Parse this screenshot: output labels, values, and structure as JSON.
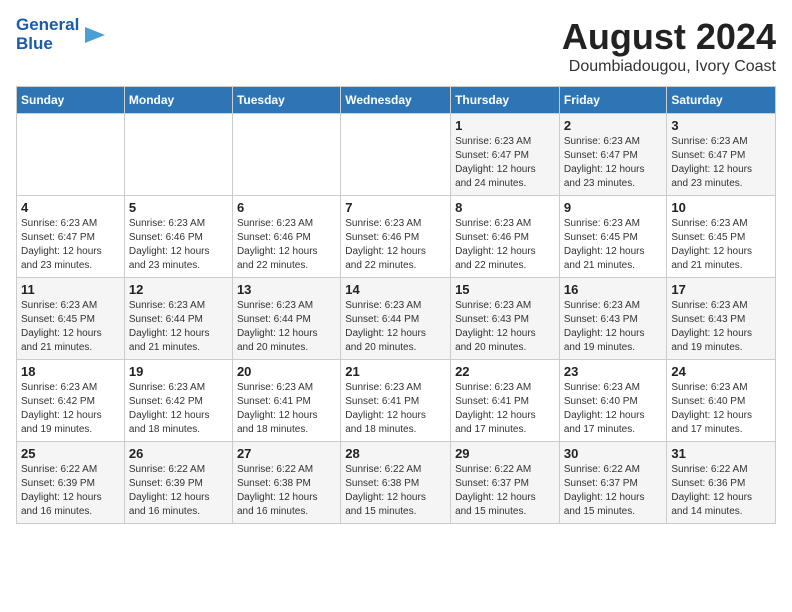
{
  "header": {
    "logo_line1": "General",
    "logo_line2": "Blue",
    "main_title": "August 2024",
    "subtitle": "Doumbiadougou, Ivory Coast"
  },
  "weekdays": [
    "Sunday",
    "Monday",
    "Tuesday",
    "Wednesday",
    "Thursday",
    "Friday",
    "Saturday"
  ],
  "weeks": [
    [
      {
        "day": "",
        "info": ""
      },
      {
        "day": "",
        "info": ""
      },
      {
        "day": "",
        "info": ""
      },
      {
        "day": "",
        "info": ""
      },
      {
        "day": "1",
        "info": "Sunrise: 6:23 AM\nSunset: 6:47 PM\nDaylight: 12 hours\nand 24 minutes."
      },
      {
        "day": "2",
        "info": "Sunrise: 6:23 AM\nSunset: 6:47 PM\nDaylight: 12 hours\nand 23 minutes."
      },
      {
        "day": "3",
        "info": "Sunrise: 6:23 AM\nSunset: 6:47 PM\nDaylight: 12 hours\nand 23 minutes."
      }
    ],
    [
      {
        "day": "4",
        "info": "Sunrise: 6:23 AM\nSunset: 6:47 PM\nDaylight: 12 hours\nand 23 minutes."
      },
      {
        "day": "5",
        "info": "Sunrise: 6:23 AM\nSunset: 6:46 PM\nDaylight: 12 hours\nand 23 minutes."
      },
      {
        "day": "6",
        "info": "Sunrise: 6:23 AM\nSunset: 6:46 PM\nDaylight: 12 hours\nand 22 minutes."
      },
      {
        "day": "7",
        "info": "Sunrise: 6:23 AM\nSunset: 6:46 PM\nDaylight: 12 hours\nand 22 minutes."
      },
      {
        "day": "8",
        "info": "Sunrise: 6:23 AM\nSunset: 6:46 PM\nDaylight: 12 hours\nand 22 minutes."
      },
      {
        "day": "9",
        "info": "Sunrise: 6:23 AM\nSunset: 6:45 PM\nDaylight: 12 hours\nand 21 minutes."
      },
      {
        "day": "10",
        "info": "Sunrise: 6:23 AM\nSunset: 6:45 PM\nDaylight: 12 hours\nand 21 minutes."
      }
    ],
    [
      {
        "day": "11",
        "info": "Sunrise: 6:23 AM\nSunset: 6:45 PM\nDaylight: 12 hours\nand 21 minutes."
      },
      {
        "day": "12",
        "info": "Sunrise: 6:23 AM\nSunset: 6:44 PM\nDaylight: 12 hours\nand 21 minutes."
      },
      {
        "day": "13",
        "info": "Sunrise: 6:23 AM\nSunset: 6:44 PM\nDaylight: 12 hours\nand 20 minutes."
      },
      {
        "day": "14",
        "info": "Sunrise: 6:23 AM\nSunset: 6:44 PM\nDaylight: 12 hours\nand 20 minutes."
      },
      {
        "day": "15",
        "info": "Sunrise: 6:23 AM\nSunset: 6:43 PM\nDaylight: 12 hours\nand 20 minutes."
      },
      {
        "day": "16",
        "info": "Sunrise: 6:23 AM\nSunset: 6:43 PM\nDaylight: 12 hours\nand 19 minutes."
      },
      {
        "day": "17",
        "info": "Sunrise: 6:23 AM\nSunset: 6:43 PM\nDaylight: 12 hours\nand 19 minutes."
      }
    ],
    [
      {
        "day": "18",
        "info": "Sunrise: 6:23 AM\nSunset: 6:42 PM\nDaylight: 12 hours\nand 19 minutes."
      },
      {
        "day": "19",
        "info": "Sunrise: 6:23 AM\nSunset: 6:42 PM\nDaylight: 12 hours\nand 18 minutes."
      },
      {
        "day": "20",
        "info": "Sunrise: 6:23 AM\nSunset: 6:41 PM\nDaylight: 12 hours\nand 18 minutes."
      },
      {
        "day": "21",
        "info": "Sunrise: 6:23 AM\nSunset: 6:41 PM\nDaylight: 12 hours\nand 18 minutes."
      },
      {
        "day": "22",
        "info": "Sunrise: 6:23 AM\nSunset: 6:41 PM\nDaylight: 12 hours\nand 17 minutes."
      },
      {
        "day": "23",
        "info": "Sunrise: 6:23 AM\nSunset: 6:40 PM\nDaylight: 12 hours\nand 17 minutes."
      },
      {
        "day": "24",
        "info": "Sunrise: 6:23 AM\nSunset: 6:40 PM\nDaylight: 12 hours\nand 17 minutes."
      }
    ],
    [
      {
        "day": "25",
        "info": "Sunrise: 6:22 AM\nSunset: 6:39 PM\nDaylight: 12 hours\nand 16 minutes."
      },
      {
        "day": "26",
        "info": "Sunrise: 6:22 AM\nSunset: 6:39 PM\nDaylight: 12 hours\nand 16 minutes."
      },
      {
        "day": "27",
        "info": "Sunrise: 6:22 AM\nSunset: 6:38 PM\nDaylight: 12 hours\nand 16 minutes."
      },
      {
        "day": "28",
        "info": "Sunrise: 6:22 AM\nSunset: 6:38 PM\nDaylight: 12 hours\nand 15 minutes."
      },
      {
        "day": "29",
        "info": "Sunrise: 6:22 AM\nSunset: 6:37 PM\nDaylight: 12 hours\nand 15 minutes."
      },
      {
        "day": "30",
        "info": "Sunrise: 6:22 AM\nSunset: 6:37 PM\nDaylight: 12 hours\nand 15 minutes."
      },
      {
        "day": "31",
        "info": "Sunrise: 6:22 AM\nSunset: 6:36 PM\nDaylight: 12 hours\nand 14 minutes."
      }
    ]
  ]
}
